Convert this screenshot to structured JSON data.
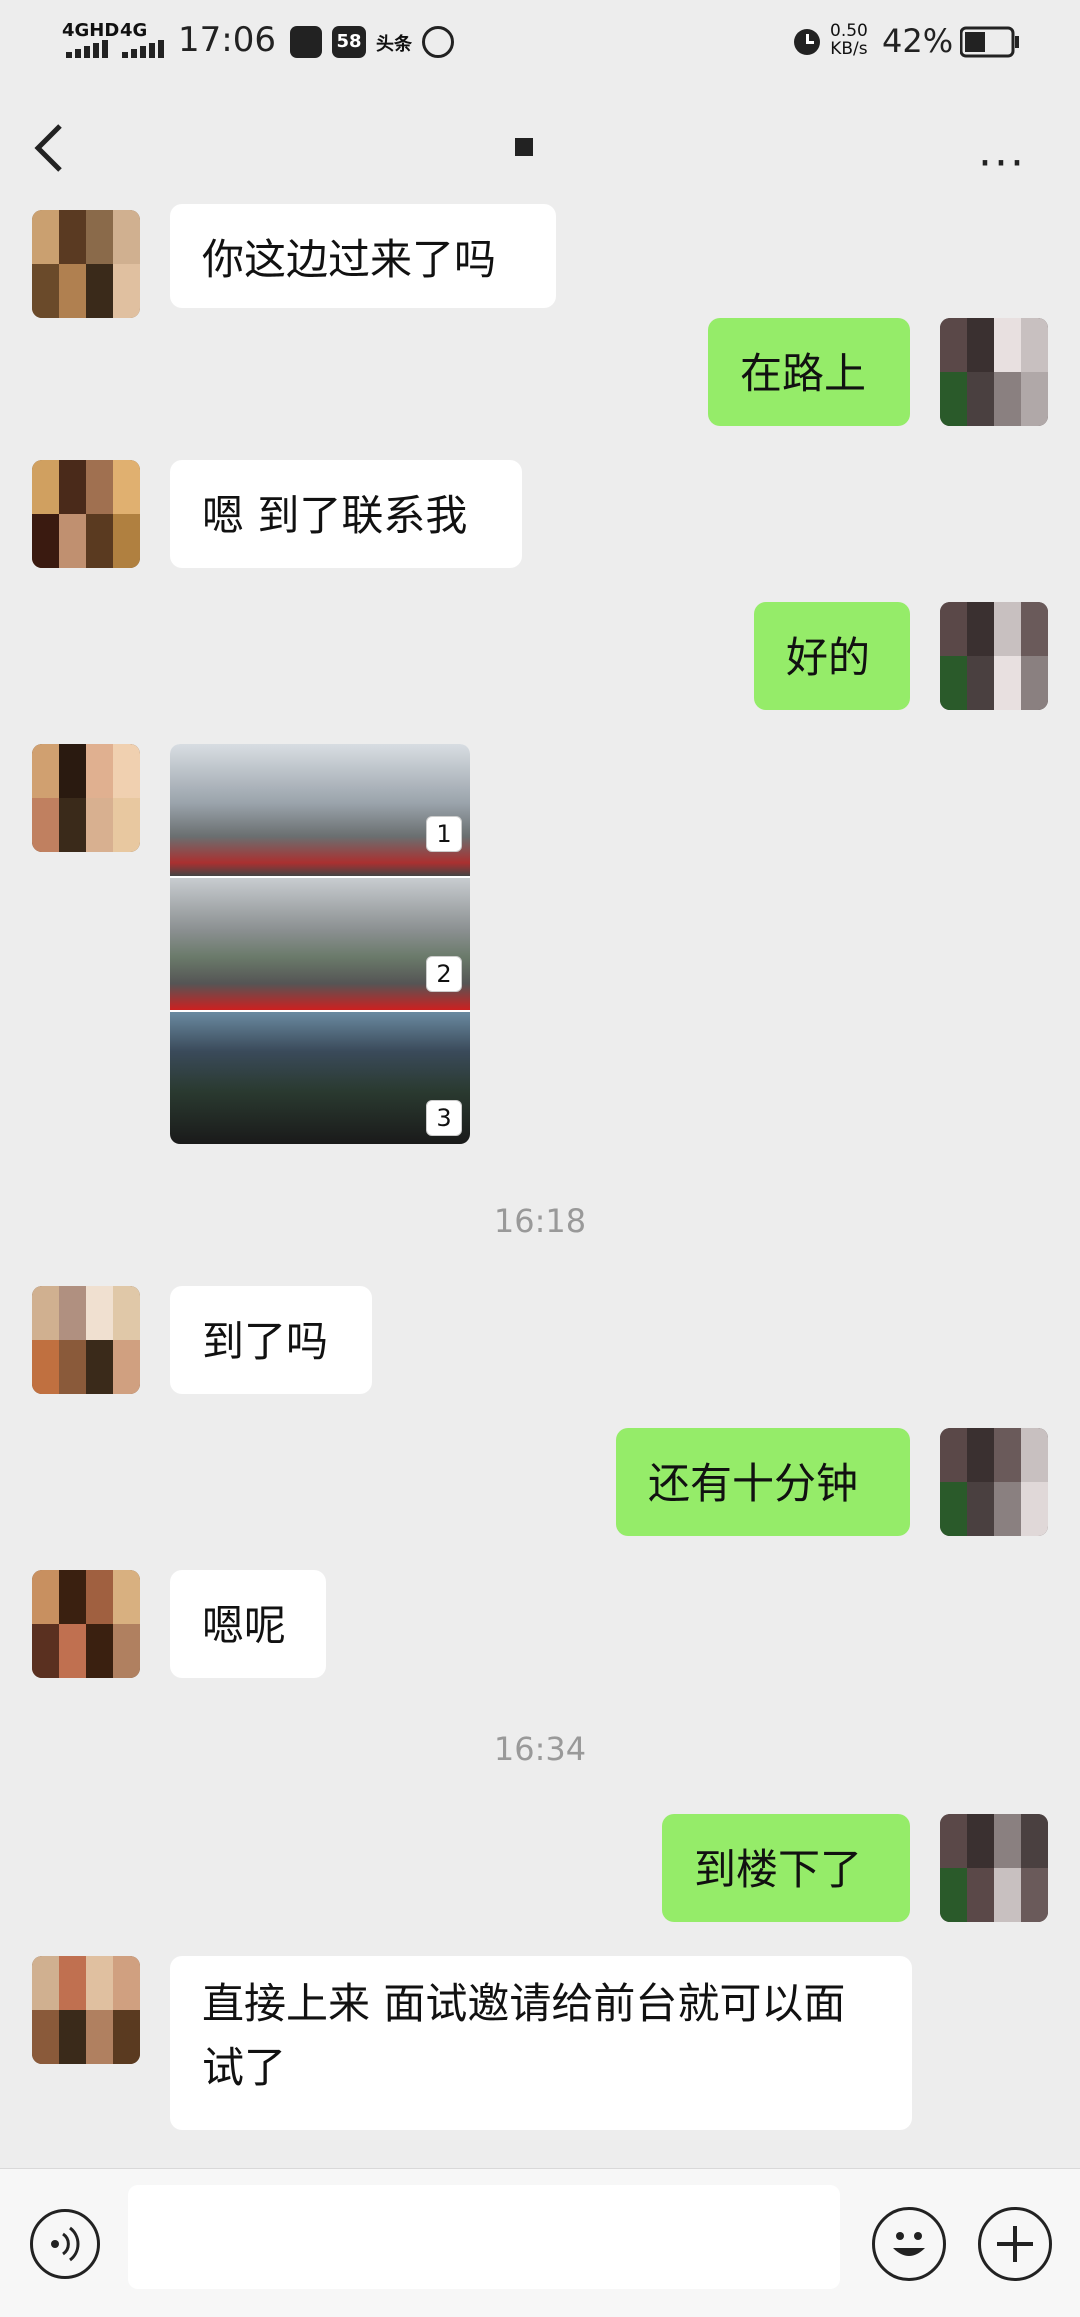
{
  "status_bar": {
    "sig1_label": "4GHD",
    "sig2_label": "4G",
    "time": "17:06",
    "app_badge": "58",
    "toutiao": "头条",
    "net_speed_value": "0.50",
    "net_speed_unit": "KB/s",
    "battery": "42%"
  },
  "nav": {
    "title": "",
    "more_label": "···"
  },
  "messages": [
    {
      "dir": "in",
      "text": "你这边过来了吗"
    },
    {
      "dir": "out",
      "text": "在路上"
    },
    {
      "dir": "in",
      "text": "嗯 到了联系我"
    },
    {
      "dir": "out",
      "text": "好的"
    },
    {
      "dir": "in",
      "type": "image",
      "labels": [
        "1",
        "2",
        "3"
      ]
    },
    {
      "type": "time",
      "text": "16:18"
    },
    {
      "dir": "in",
      "text": "到了吗"
    },
    {
      "dir": "out",
      "text": "还有十分钟"
    },
    {
      "dir": "in",
      "text": "嗯呢"
    },
    {
      "type": "time",
      "text": "16:34"
    },
    {
      "dir": "out",
      "text": "到楼下了"
    },
    {
      "dir": "in",
      "text": "直接上来 面试邀请给前台就可以面试了"
    }
  ],
  "colors": {
    "outgoing_bubble": "#95ec69",
    "incoming_bubble": "#ffffff",
    "background": "#ededed"
  },
  "input_bar": {
    "voice_icon": "voice-icon",
    "emoji_icon": "emoji-icon",
    "plus_icon": "plus-icon"
  }
}
